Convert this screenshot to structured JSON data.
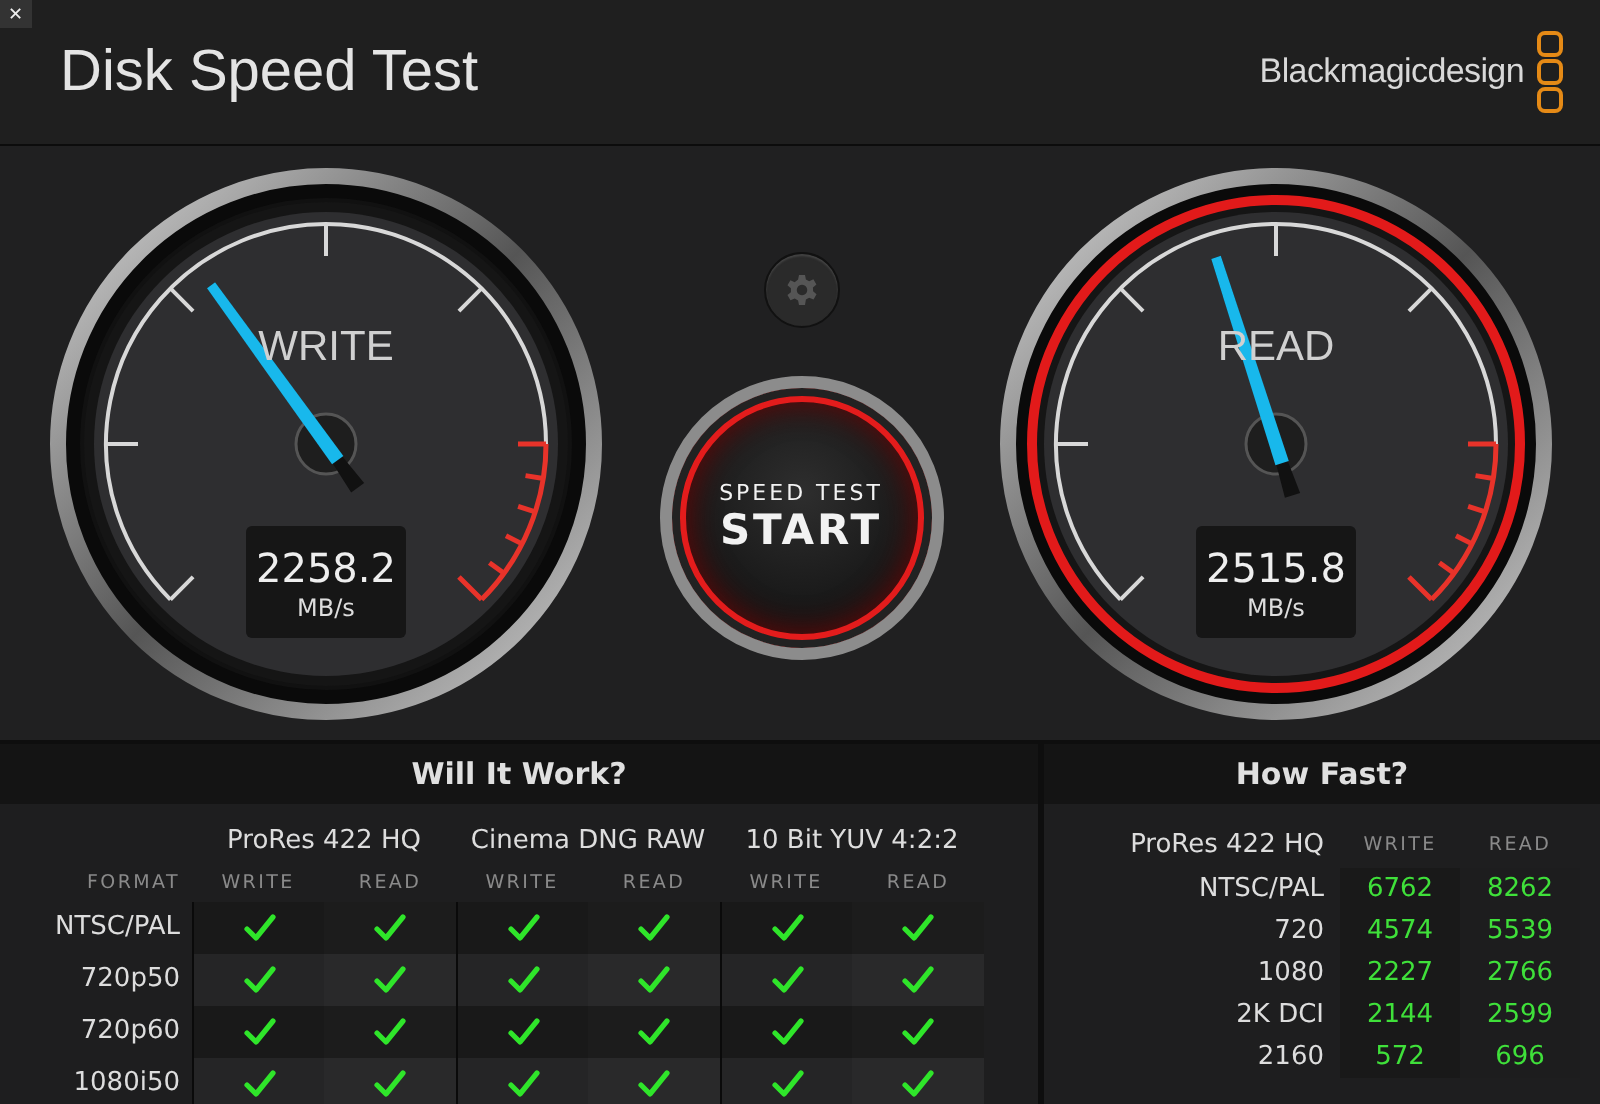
{
  "window": {
    "close_button": "✕",
    "title": "Disk Speed Test",
    "brand": "Blackmagicdesign"
  },
  "gauges": [
    {
      "label": "WRITE",
      "value": "2258.2",
      "unit": "MB/s",
      "level": 0.367,
      "active": false
    },
    {
      "label": "READ",
      "value": "2515.8",
      "unit": "MB/s",
      "level": 0.434,
      "active": true
    }
  ],
  "start_button": {
    "caption": "SPEED TEST",
    "label": "START"
  },
  "will_it_work": {
    "title": "Will It Work?",
    "format_label": "FORMAT",
    "groups": [
      {
        "name": "ProRes 422 HQ",
        "columns": [
          "WRITE",
          "READ"
        ]
      },
      {
        "name": "Cinema DNG RAW",
        "columns": [
          "WRITE",
          "READ"
        ]
      },
      {
        "name": "10 Bit YUV 4:2:2",
        "columns": [
          "WRITE",
          "READ"
        ]
      }
    ],
    "rows": [
      {
        "format": "NTSC/PAL",
        "results": [
          true,
          true,
          true,
          true,
          true,
          true
        ]
      },
      {
        "format": "720p50",
        "results": [
          true,
          true,
          true,
          true,
          true,
          true
        ]
      },
      {
        "format": "720p60",
        "results": [
          true,
          true,
          true,
          true,
          true,
          true
        ]
      },
      {
        "format": "1080i50",
        "results": [
          true,
          true,
          true,
          true,
          true,
          true
        ]
      }
    ]
  },
  "how_fast": {
    "title": "How Fast?",
    "group": "ProRes 422 HQ",
    "columns": [
      "WRITE",
      "READ"
    ],
    "rows": [
      {
        "format": "NTSC/PAL",
        "write": "6762",
        "read": "8262"
      },
      {
        "format": "720",
        "write": "4574",
        "read": "5539"
      },
      {
        "format": "1080",
        "write": "2227",
        "read": "2766"
      },
      {
        "format": "2K DCI",
        "write": "2144",
        "read": "2599"
      },
      {
        "format": "2160",
        "write": "572",
        "read": "696"
      }
    ]
  }
}
